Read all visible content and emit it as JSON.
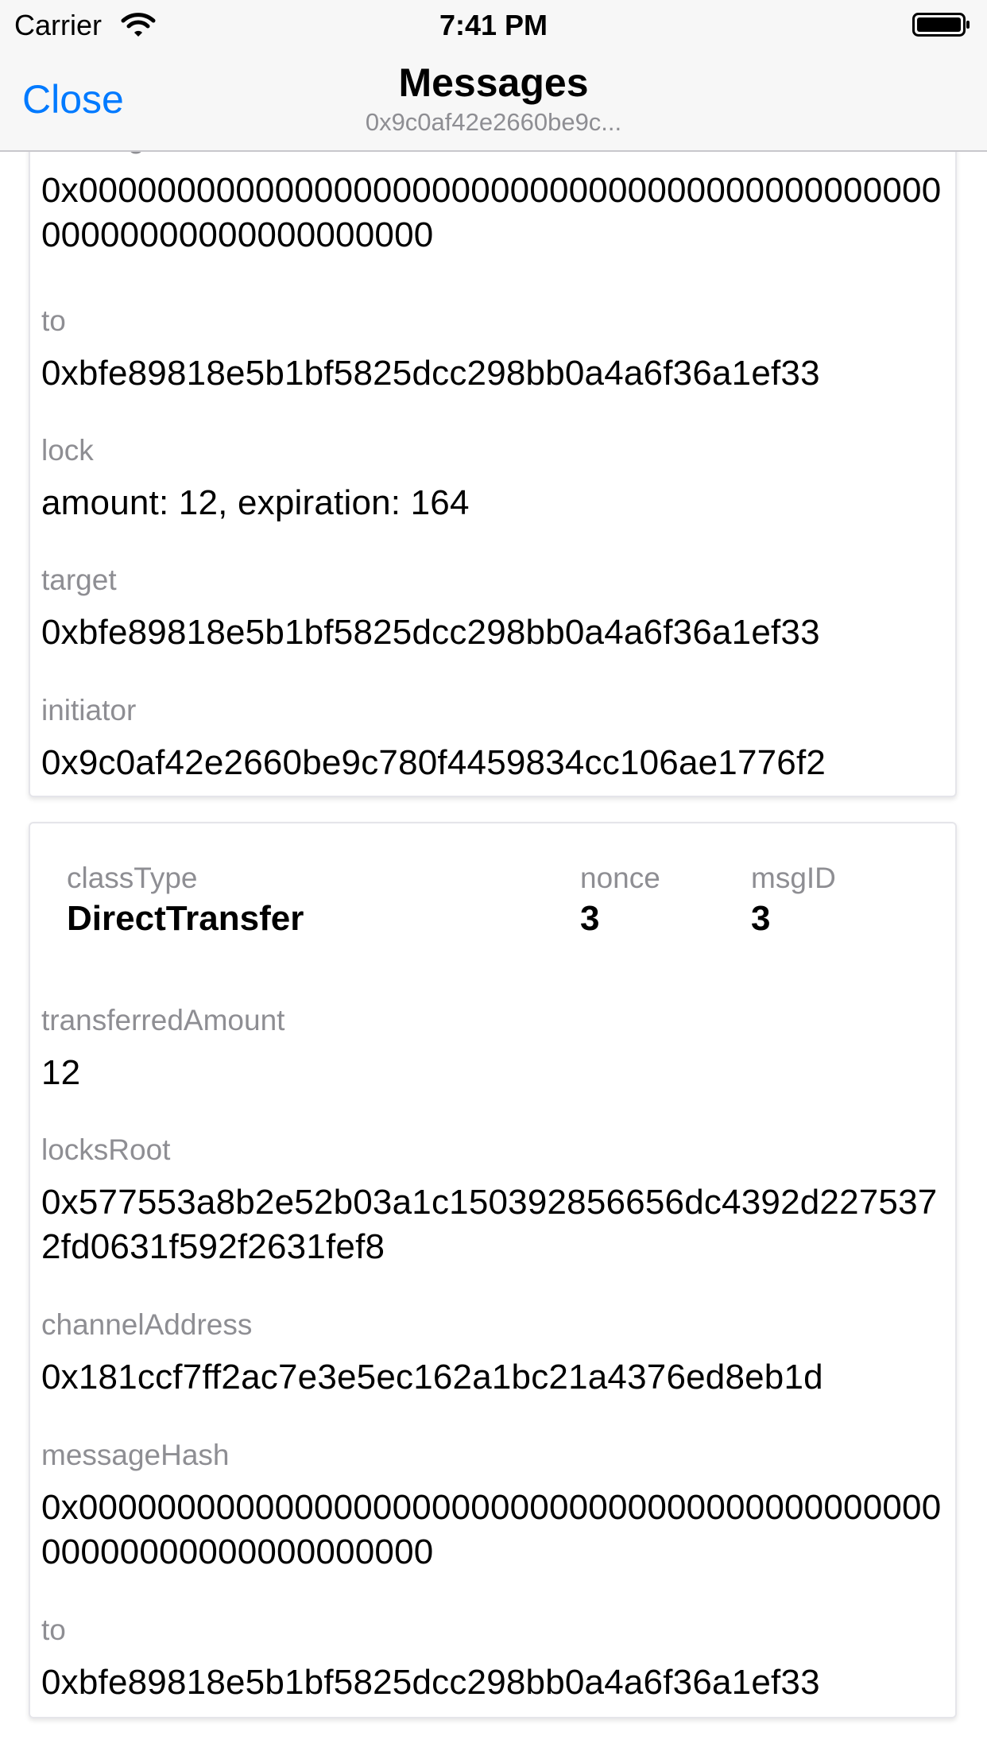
{
  "status_bar": {
    "carrier": "Carrier",
    "time": "7:41 PM",
    "wifi_icon": "wifi-icon",
    "battery_icon": "battery-full-icon"
  },
  "nav": {
    "close_label": "Close",
    "title": "Messages",
    "subtitle": "0x9c0af42e2660be9c..."
  },
  "cards": [
    {
      "fields": [
        {
          "label": "messageHash",
          "value": "0x0000000000000000000000000000000000000000000000000000000000000000"
        },
        {
          "label": "to",
          "value": "0xbfe89818e5b1bf5825dcc298bb0a4a6f36a1ef33"
        },
        {
          "label": "lock",
          "value": "amount: 12, expiration: 164"
        },
        {
          "label": "target",
          "value": "0xbfe89818e5b1bf5825dcc298bb0a4a6f36a1ef33"
        },
        {
          "label": "initiator",
          "value": "0x9c0af42e2660be9c780f4459834cc106ae1776f2"
        }
      ]
    },
    {
      "header": {
        "class_type_label": "classType",
        "class_type_value": "DirectTransfer",
        "nonce_label": "nonce",
        "nonce_value": "3",
        "msg_id_label": "msgID",
        "msg_id_value": "3"
      },
      "fields": [
        {
          "label": "transferredAmount",
          "value": "12"
        },
        {
          "label": "locksRoot",
          "value": "0x577553a8b2e52b03a1c150392856656dc4392d2275372fd0631f592f2631fef8"
        },
        {
          "label": "channelAddress",
          "value": "0x181ccf7ff2ac7e3e5ec162a1bc21a4376ed8eb1d"
        },
        {
          "label": "messageHash",
          "value": "0x0000000000000000000000000000000000000000000000000000000000000000"
        },
        {
          "label": "to",
          "value": "0xbfe89818e5b1bf5825dcc298bb0a4a6f36a1ef33"
        }
      ]
    }
  ],
  "colors": {
    "accent": "#007aff",
    "label_gray": "#8e8e93",
    "card_border": "#e5e5ea",
    "bar_bg": "#f7f7f7"
  }
}
